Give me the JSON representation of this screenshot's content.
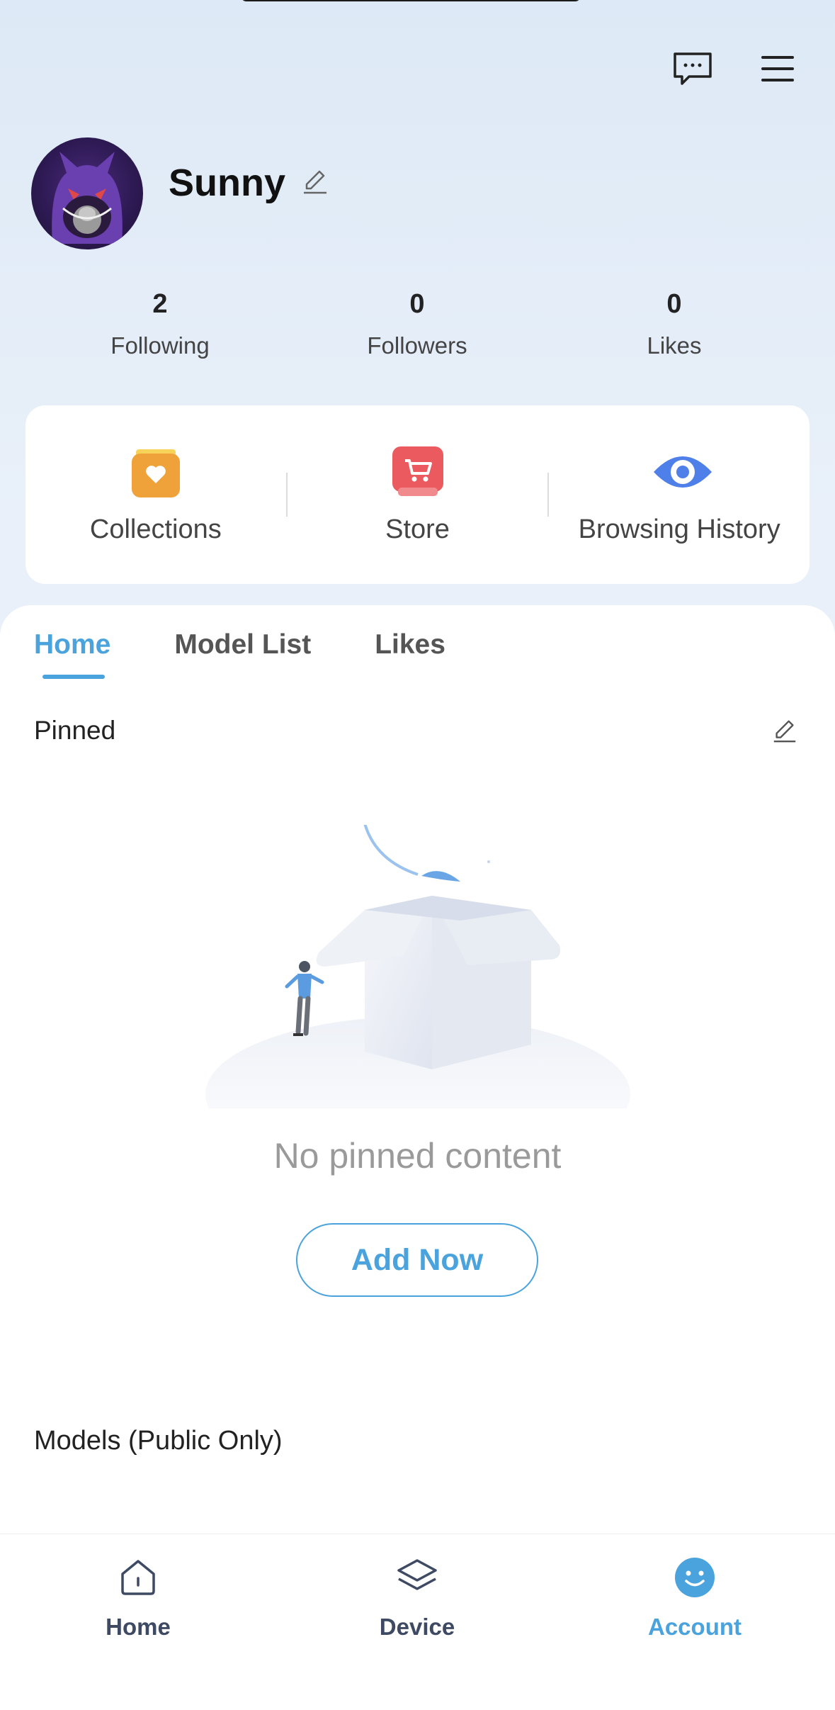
{
  "header": {
    "message_icon": "chat-bubble-icon",
    "menu_icon": "hamburger-menu-icon"
  },
  "profile": {
    "username": "Sunny",
    "edit_icon": "pencil-icon"
  },
  "stats": [
    {
      "value": "2",
      "label": "Following"
    },
    {
      "value": "0",
      "label": "Followers"
    },
    {
      "value": "0",
      "label": "Likes"
    }
  ],
  "quick_actions": [
    {
      "label": "Collections",
      "icon": "collections-jar-icon",
      "color": "#f0a23a"
    },
    {
      "label": "Store",
      "icon": "cart-icon",
      "color": "#ea5a5f"
    },
    {
      "label": "Browsing History",
      "icon": "eye-icon",
      "color": "#4f7fe8"
    }
  ],
  "tabs": [
    {
      "label": "Home",
      "active": true
    },
    {
      "label": "Model List",
      "active": false
    },
    {
      "label": "Likes",
      "active": false
    }
  ],
  "pinned": {
    "heading": "Pinned",
    "empty_text": "No pinned content",
    "add_button": "Add Now"
  },
  "models": {
    "heading": "Models (Public Only)"
  },
  "bottom_nav": [
    {
      "label": "Home",
      "icon": "home-icon",
      "active": false
    },
    {
      "label": "Device",
      "icon": "layers-icon",
      "active": false
    },
    {
      "label": "Account",
      "icon": "smiley-account-icon",
      "active": true
    }
  ],
  "colors": {
    "accent": "#4aa3dc",
    "nav_inactive": "#3e4a63"
  }
}
